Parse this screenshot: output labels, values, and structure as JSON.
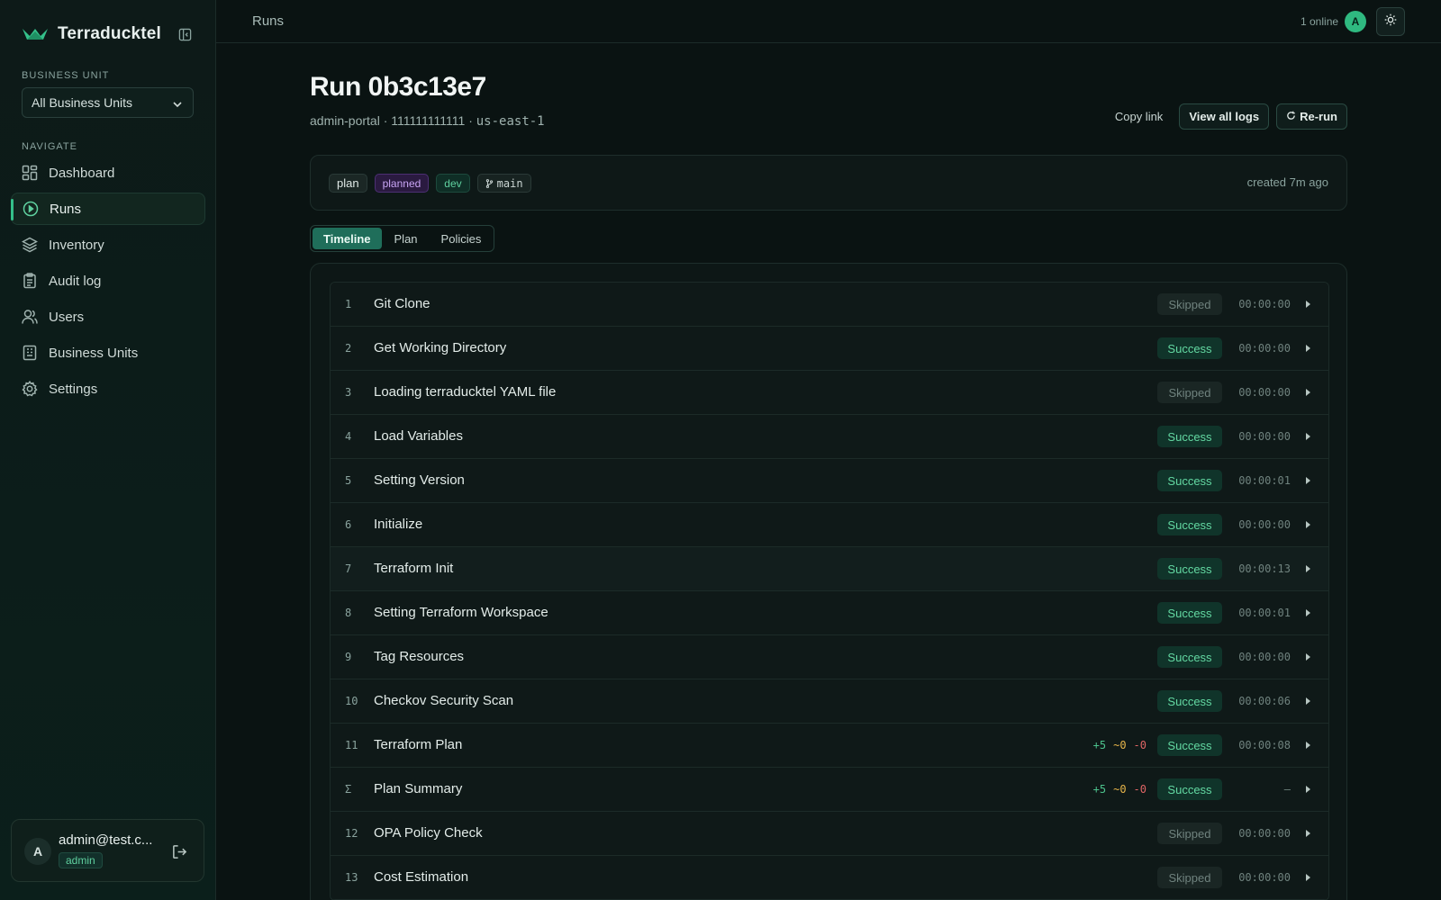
{
  "app": {
    "name": "Terraducktel"
  },
  "sidebar": {
    "business_unit_label": "BUSINESS UNIT",
    "business_unit_value": "All Business Units",
    "navigate_label": "NAVIGATE",
    "items": [
      {
        "label": "Dashboard",
        "icon": "dashboard-icon"
      },
      {
        "label": "Runs",
        "icon": "runs-icon",
        "active": true
      },
      {
        "label": "Inventory",
        "icon": "layers-icon"
      },
      {
        "label": "Audit log",
        "icon": "clipboard-icon"
      },
      {
        "label": "Users",
        "icon": "users-icon"
      },
      {
        "label": "Business Units",
        "icon": "building-icon"
      },
      {
        "label": "Settings",
        "icon": "gear-icon"
      }
    ],
    "user": {
      "initial": "A",
      "email": "admin@test.c...",
      "role": "admin"
    }
  },
  "topbar": {
    "breadcrumb": "Runs",
    "online": "1 online",
    "avatar_initial": "A"
  },
  "run": {
    "title": "Run 0b3c13e7",
    "project": "admin-portal",
    "account": "111111111111",
    "region": "us-east-1",
    "sep": "·",
    "actions": {
      "copy_link": "Copy link",
      "view_logs": "View all logs",
      "rerun": "Re-run"
    },
    "tags": {
      "type": "plan",
      "state": "planned",
      "env": "dev",
      "branch": "main"
    },
    "created": "created 7m ago"
  },
  "tabs": [
    {
      "label": "Timeline",
      "active": true
    },
    {
      "label": "Plan"
    },
    {
      "label": "Policies"
    }
  ],
  "steps": [
    {
      "num": "1",
      "name": "Git Clone",
      "status": "Skipped",
      "duration": "00:00:00"
    },
    {
      "num": "2",
      "name": "Get Working Directory",
      "status": "Success",
      "duration": "00:00:00"
    },
    {
      "num": "3",
      "name": "Loading terraducktel YAML file",
      "status": "Skipped",
      "duration": "00:00:00"
    },
    {
      "num": "4",
      "name": "Load Variables",
      "status": "Success",
      "duration": "00:00:00"
    },
    {
      "num": "5",
      "name": "Setting Version",
      "status": "Success",
      "duration": "00:00:01"
    },
    {
      "num": "6",
      "name": "Initialize",
      "status": "Success",
      "duration": "00:00:00"
    },
    {
      "num": "7",
      "name": "Terraform Init",
      "status": "Success",
      "duration": "00:00:13",
      "highlight": true
    },
    {
      "num": "8",
      "name": "Setting Terraform Workspace",
      "status": "Success",
      "duration": "00:00:01"
    },
    {
      "num": "9",
      "name": "Tag Resources",
      "status": "Success",
      "duration": "00:00:00"
    },
    {
      "num": "10",
      "name": "Checkov Security Scan",
      "status": "Success",
      "duration": "00:00:06"
    },
    {
      "num": "11",
      "name": "Terraform Plan",
      "status": "Success",
      "duration": "00:00:08",
      "diff": {
        "add": "+5",
        "change": "~0",
        "destroy": "-0"
      }
    },
    {
      "num": "Σ",
      "name": "Plan Summary",
      "status": "Success",
      "duration": "—",
      "diff": {
        "add": "+5",
        "change": "~0",
        "destroy": "-0"
      }
    },
    {
      "num": "12",
      "name": "OPA Policy Check",
      "status": "Skipped",
      "duration": "00:00:00"
    },
    {
      "num": "13",
      "name": "Cost Estimation",
      "status": "Skipped",
      "duration": "00:00:00"
    }
  ],
  "colors": {
    "accent": "#34c08a",
    "success_text": "#63d8a2",
    "success_bg": "#10342a",
    "skipped_text": "#6f827e",
    "planned": "#c9a5f5",
    "add": "#4cc28c",
    "change": "#e7b54a",
    "destroy": "#e06565"
  }
}
